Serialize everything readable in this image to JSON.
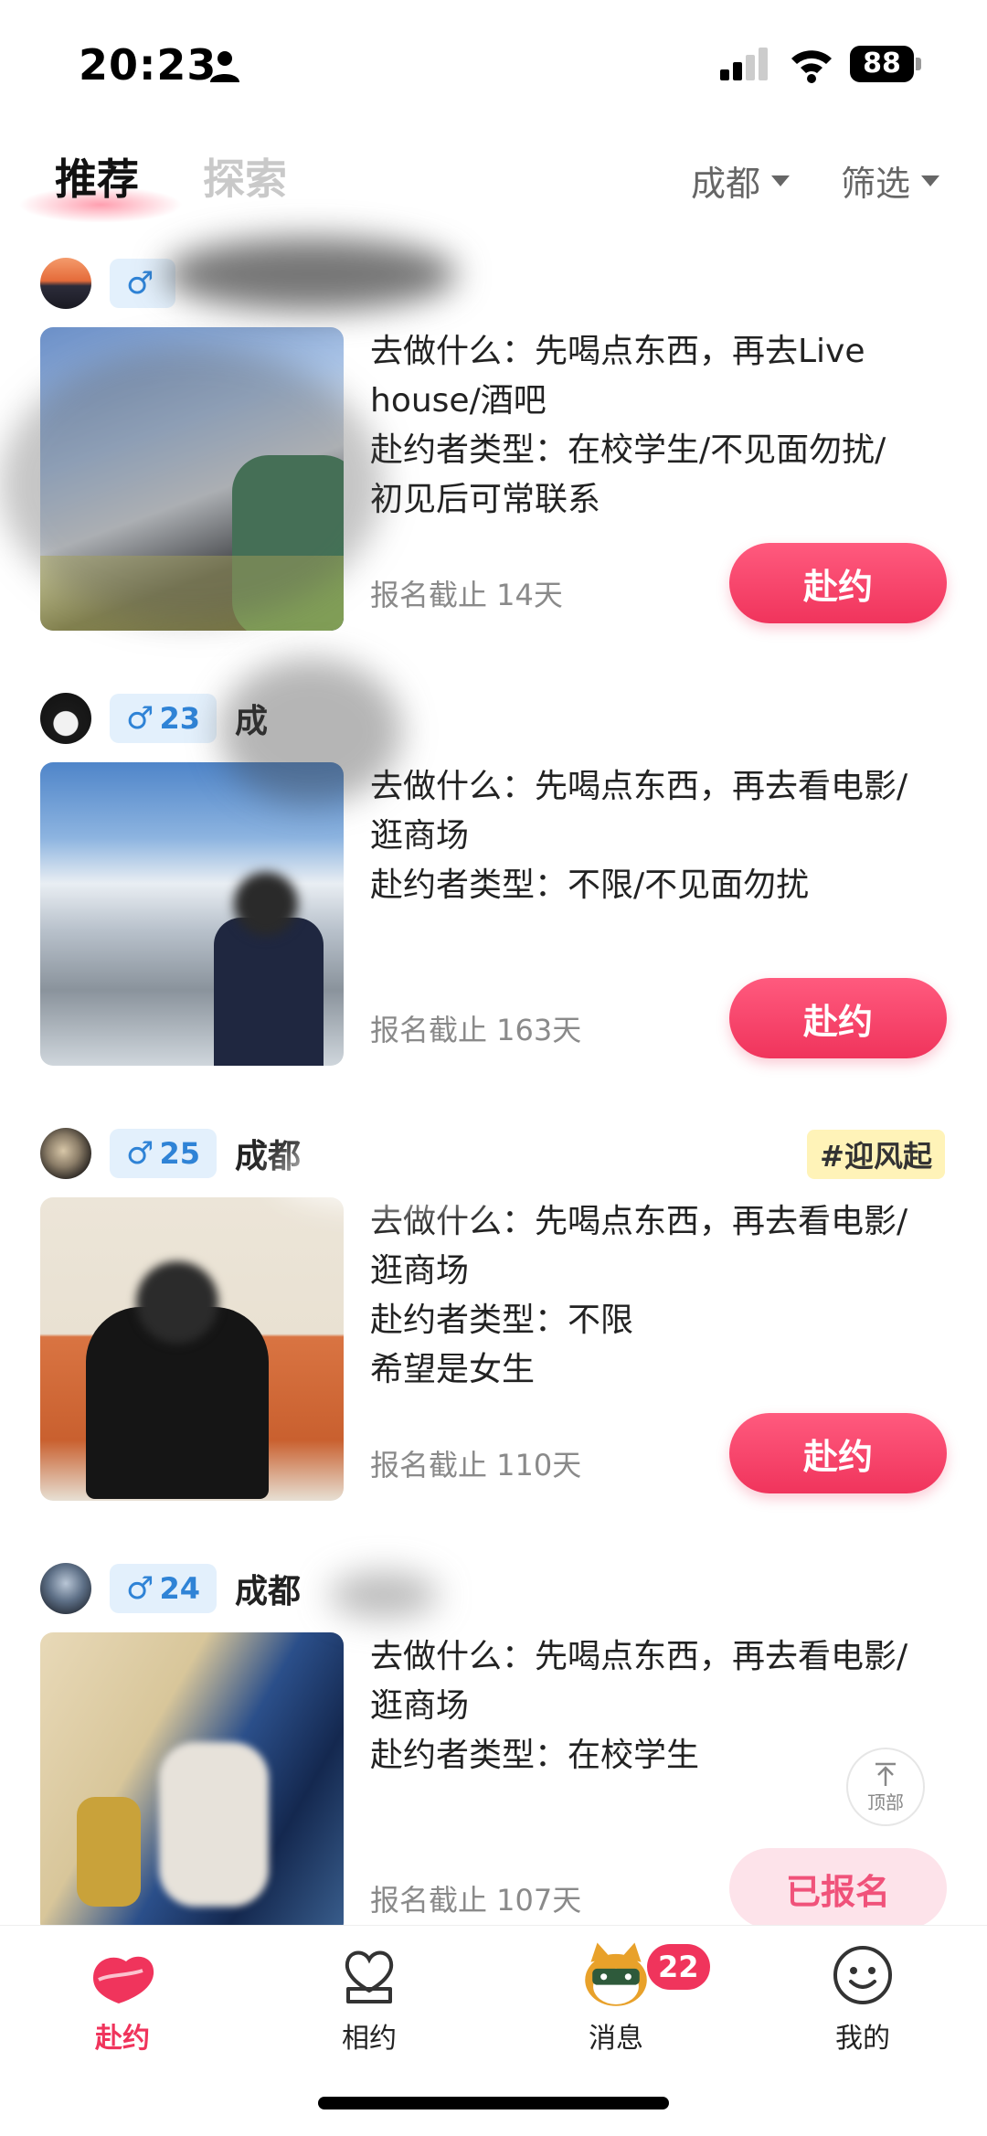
{
  "status_bar": {
    "time": "20:23",
    "battery": "88"
  },
  "top_nav": {
    "tabs": [
      {
        "label": "推荐",
        "active": true
      },
      {
        "label": "探索",
        "active": false
      }
    ],
    "city": "成都",
    "filter": "筛选"
  },
  "posts": [
    {
      "gender_symbol": "♂",
      "age": "",
      "city": "",
      "tag": "",
      "desc_lines": [
        "去做什么：先喝点东西，再去Live",
        "house/酒吧",
        "赴约者类型：在校学生/不见面勿扰/",
        "初见后可常联系"
      ],
      "deadline": "报名截止 14天",
      "button": "赴约"
    },
    {
      "gender_symbol": "♂",
      "age": "23",
      "city": "成",
      "tag": "",
      "desc_lines": [
        "去做什么：先喝点东西，再去看电影/",
        "逛商场",
        "赴约者类型：不限/不见面勿扰"
      ],
      "deadline": "报名截止 163天",
      "button": "赴约"
    },
    {
      "gender_symbol": "♂",
      "age": "25",
      "city": "成都",
      "tag": "#迎风起",
      "desc_lines": [
        "去做什么：先喝点东西，再去看电影/",
        "逛商场",
        "赴约者类型：不限",
        "希望是女生"
      ],
      "deadline": "报名截止 110天",
      "button": "赴约"
    },
    {
      "gender_symbol": "♂",
      "age": "24",
      "city": "成都",
      "tag": "",
      "desc_lines": [
        "去做什么：先喝点东西，再去看电影/",
        "逛商场",
        "赴约者类型：在校学生"
      ],
      "deadline": "报名截止 107天",
      "button": "已报名"
    }
  ],
  "back_to_top": "顶部",
  "bottom_nav": [
    {
      "label": "赴约",
      "icon": "date-icon",
      "active": true
    },
    {
      "label": "相约",
      "icon": "heart-chat-icon",
      "active": false
    },
    {
      "label": "消息",
      "icon": "cat-avatar-icon",
      "active": false,
      "badge": "22"
    },
    {
      "label": "我的",
      "icon": "smile-icon",
      "active": false
    }
  ],
  "colors": {
    "accent": "#f0345c",
    "gender_badge_bg": "#e3f0fc",
    "gender_badge_fg": "#2f83d6",
    "tag_bg": "#fff3b8"
  }
}
